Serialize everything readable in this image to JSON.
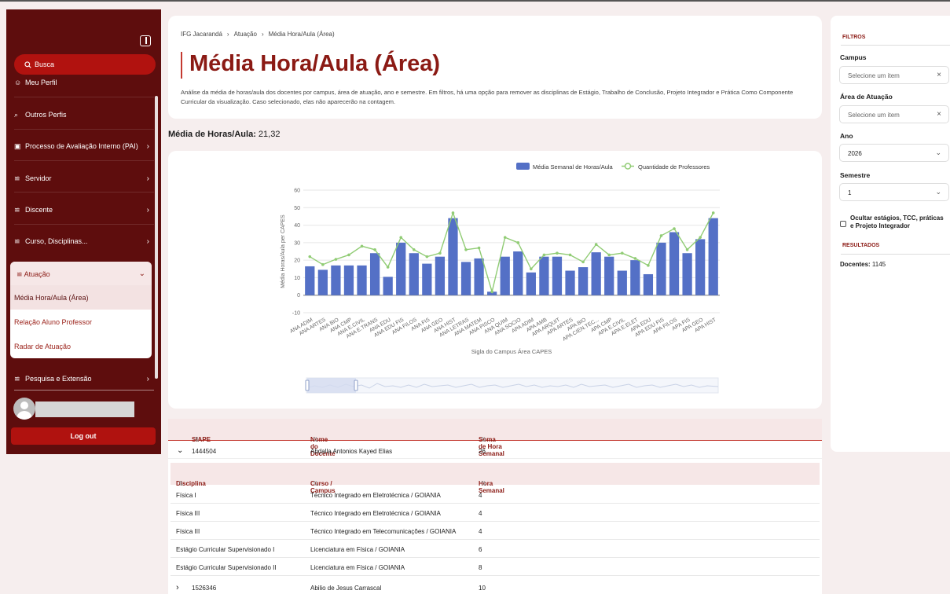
{
  "sidebar": {
    "search": "Busca",
    "items": [
      {
        "label": "Meu Perfil",
        "icon": "user-icon"
      },
      {
        "label": "Outros Perfis",
        "icon": "search-user-icon"
      },
      {
        "label": "Processo de Avaliação Interno (PAI)",
        "icon": "book-icon"
      },
      {
        "label": "Servidor",
        "icon": "sliders-icon"
      },
      {
        "label": "Discente",
        "icon": "sliders-icon"
      },
      {
        "label": "Curso, Disciplinas...",
        "icon": "sliders-icon"
      }
    ],
    "group": {
      "label": "Atuação",
      "subitems": [
        "Média Hora/Aula (Área)",
        "Relação Aluno Professor",
        "Radar de Atuação"
      ]
    },
    "after_items": [
      {
        "label": "Pesquisa e Extensão",
        "icon": "sliders-icon"
      }
    ],
    "logout": "Log out"
  },
  "header": {
    "breadcrumb": [
      "IFG Jacarandá",
      "Atuação",
      "Média Hora/Aula (Área)"
    ],
    "title": "Média Hora/Aula (Área)",
    "description": "Análise da média de horas/aula dos docentes por campus, área de atuação, ano e semestre. Em filtros, há uma opção para remover as disciplinas de Estágio, Trabalho de Conclusão, Projeto Integrador e Prática Como Componente Curricular da visualização. Caso selecionado, elas não aparecerão na contagem."
  },
  "summary": {
    "label": "Média de Horas/Aula:",
    "value": "21,32"
  },
  "chart_data": {
    "type": "bar",
    "xlabel": "Sigla do Campus Área CAPES",
    "ylabel": "Média Horas/Aula per CAPES",
    "ylim": [
      -10,
      60
    ],
    "yticks": [
      -10,
      0,
      10,
      20,
      30,
      40,
      50,
      60
    ],
    "grid": true,
    "legend_position": "top-right",
    "categories": [
      "ANA ADIM",
      "ANA ARTES",
      "ANA BIO",
      "ANA CMP",
      "ANA E.CIVIL",
      "ANA E.TRANS",
      "ANA EDU",
      "ANA EDU FIS",
      "ANA FILOS",
      "ANA FIS",
      "ANA GEO",
      "ANA HIST",
      "ANA LETRAS",
      "ANA MATEM",
      "ANA PISCO",
      "ANA QUIM",
      "ANA SOCIO",
      "APA ADIM",
      "APA AMB",
      "APA ARQUIT",
      "APA ARTES",
      "APA BIO",
      "APA CIEN.TEC...",
      "APA CMP",
      "APA E.CIVIL",
      "APA E.ELET",
      "APA EDU",
      "APA EDU FIS",
      "APA FILOS",
      "APA FIS",
      "APA GEO",
      "APA HIST"
    ],
    "series": [
      {
        "name": "Média Semanal de Horas/Aula",
        "type": "bar",
        "color": "#5470c6",
        "values": [
          16.5,
          14.5,
          17,
          17,
          17,
          24,
          10.5,
          30,
          24,
          18,
          22,
          44,
          19,
          21,
          2,
          22,
          25,
          13,
          22,
          22,
          14,
          16,
          24.5,
          22,
          14,
          20,
          12,
          30,
          36,
          24,
          32,
          44
        ]
      },
      {
        "name": "Quantidade de Professores",
        "type": "line",
        "color": "#91cc75",
        "values": [
          22,
          17.5,
          20.5,
          23,
          28,
          26,
          16,
          33,
          26,
          22,
          24,
          47,
          26,
          27,
          2,
          33,
          30,
          15,
          23,
          24,
          23,
          19,
          29,
          23,
          24,
          21,
          17,
          34,
          38,
          26,
          33,
          47
        ]
      }
    ]
  },
  "table": {
    "columns": [
      "SIAPE",
      "Nome do Docente",
      "Soma de Hora Semanal"
    ],
    "rows": [
      {
        "siape": "1444504",
        "name": "Abdalla Antonios Kayed Elias",
        "sum": "26",
        "expanded": true
      },
      {
        "siape": "1526346",
        "name": "Abilio de Jesus Carrascal",
        "sum": "10",
        "expanded": false
      }
    ],
    "sub_columns": [
      "Disciplina",
      "Curso / Campus",
      "Hora Semanal"
    ],
    "sub_rows": [
      {
        "disc": "Física I",
        "curso": "Técnico Integrado em Eletrotécnica / GOIANIA",
        "hora": "4"
      },
      {
        "disc": "Física III",
        "curso": "Técnico Integrado em Eletrotécnica / GOIANIA",
        "hora": "4"
      },
      {
        "disc": "Física III",
        "curso": "Técnico Integrado em Telecomunicações / GOIANIA",
        "hora": "4"
      },
      {
        "disc": "Estágio Curricular Supervisionado I",
        "curso": "Licenciatura em Física / GOIANIA",
        "hora": "6"
      },
      {
        "disc": "Estágio Curricular Supervisionado II",
        "curso": "Licenciatura em Física / GOIANIA",
        "hora": "8"
      }
    ]
  },
  "filters": {
    "title": "FILTROS",
    "campus_label": "Campus",
    "campus_placeholder": "Selecione um item",
    "area_label": "Área de Atuação",
    "area_placeholder": "Selecione um item",
    "ano_label": "Ano",
    "ano_value": "2026",
    "semestre_label": "Semestre",
    "semestre_value": "1",
    "checkbox_label": "Ocultar estágios, TCC, práticas e Projeto Integrador",
    "results_title": "RESULTADOS",
    "docentes_label": "Docentes:",
    "docentes_value": "1145"
  },
  "colors": {
    "brand": "#5e0d0d",
    "accent": "#b0120f",
    "title": "#8b1a14",
    "bar": "#5470c6",
    "line": "#91cc75"
  }
}
